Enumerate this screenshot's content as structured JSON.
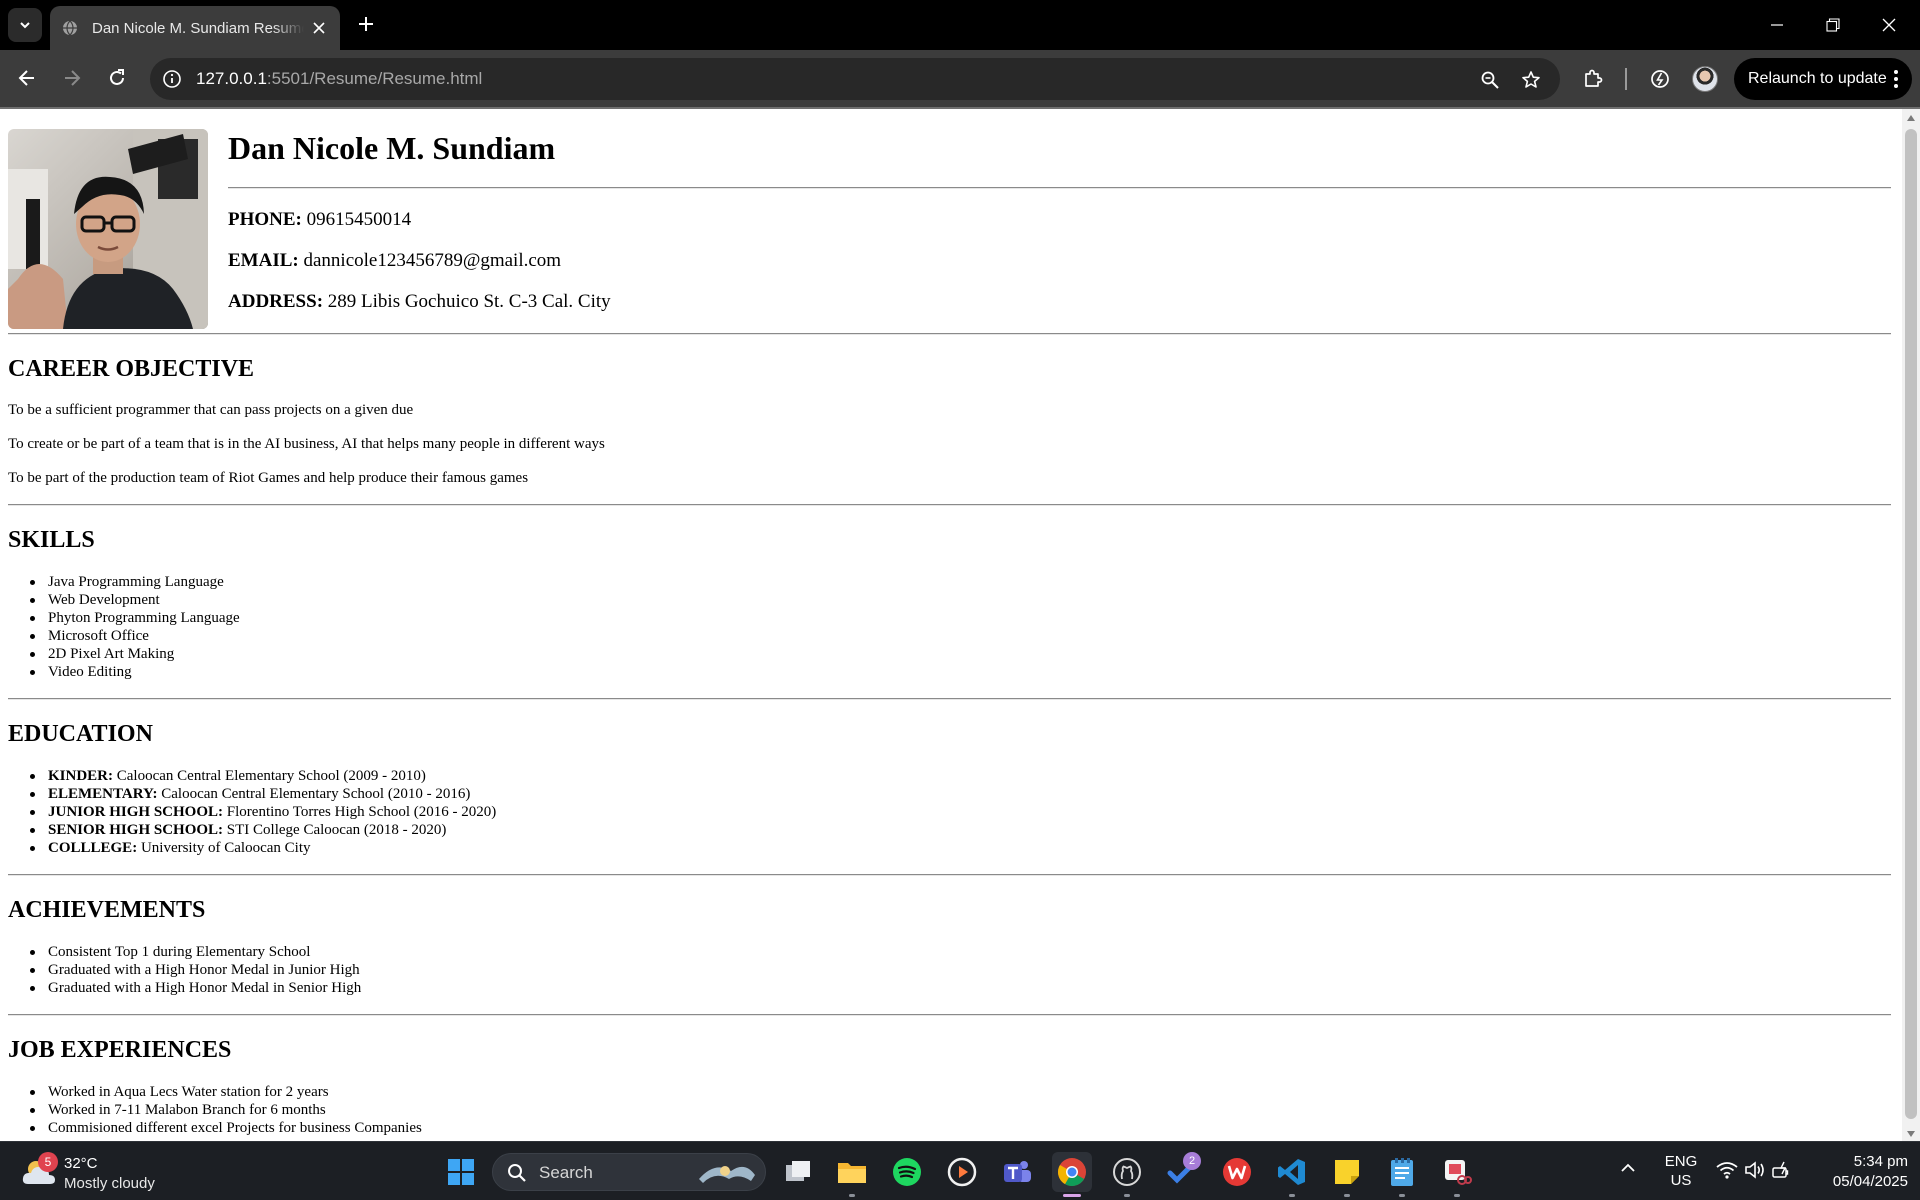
{
  "browser": {
    "tab_title": "Dan Nicole M. Sundiam Resume",
    "url_host": "127.0.0.1",
    "url_path": ":5501/Resume/Resume.html",
    "relaunch_label": "Relaunch to update"
  },
  "resume": {
    "name": "Dan Nicole M. Sundiam",
    "contact": {
      "phone_label": "PHONE:",
      "phone": "09615450014",
      "email_label": "EMAIL:",
      "email": "dannicole123456789@gmail.com",
      "address_label": "ADDRESS:",
      "address": "289 Libis Gochuico St. C-3 Cal. City"
    },
    "career_objective": {
      "heading": "CAREER OBJECTIVE",
      "items": [
        "To be a sufficient programmer that can pass projects on a given due",
        "To create or be part of a team that is in the AI business, AI that helps many people in different ways",
        "To be part of the production team of Riot Games and help produce their famous games"
      ]
    },
    "skills": {
      "heading": "SKILLS",
      "items": [
        "Java Programming Language",
        "Web Development",
        "Phyton Programming Language",
        "Microsoft Office",
        "2D Pixel Art Making",
        "Video Editing"
      ]
    },
    "education": {
      "heading": "EDUCATION",
      "items": [
        {
          "label": "KINDER:",
          "value": "Caloocan Central Elementary School (2009 - 2010)"
        },
        {
          "label": "ELEMENTARY:",
          "value": "Caloocan Central Elementary School (2010 - 2016)"
        },
        {
          "label": "JUNIOR HIGH SCHOOL:",
          "value": "Florentino Torres High School (2016 - 2020)"
        },
        {
          "label": "SENIOR HIGH SCHOOL:",
          "value": "STI College Caloocan (2018 - 2020)"
        },
        {
          "label": "COLLLEGE:",
          "value": "University of Caloocan City"
        }
      ]
    },
    "achievements": {
      "heading": "ACHIEVEMENTS",
      "items": [
        "Consistent Top 1 during Elementary School",
        "Graduated with a High Honor Medal in Junior High",
        "Graduated with a High Honor Medal in Senior High"
      ]
    },
    "job_experiences": {
      "heading": "JOB EXPERIENCES",
      "items": [
        "Worked in Aqua Lecs Water station for 2 years",
        "Worked in 7-11 Malabon Branch for 6 months",
        "Commisioned different excel Projects for business Companies"
      ]
    }
  },
  "taskbar": {
    "weather_badge": "5",
    "temperature": "32°C",
    "condition": "Mostly cloudy",
    "search_placeholder": "Search",
    "todo_badge": "2",
    "lang_line1": "ENG",
    "lang_line2": "US",
    "time": "5:34 pm",
    "date": "05/04/2025"
  },
  "icons": {
    "tab_favicon": "globe-icon",
    "profile": "avatar",
    "taskbar_apps": [
      "windows-start-icon",
      "task-view-icon",
      "file-explorer-icon",
      "spotify-icon",
      "media-player-icon",
      "teams-icon",
      "chrome-icon",
      "github-icon",
      "todo-icon",
      "wps-office-icon",
      "vscode-icon",
      "sticky-notes-icon",
      "notepad-icon",
      "snipping-tool-icon"
    ]
  }
}
